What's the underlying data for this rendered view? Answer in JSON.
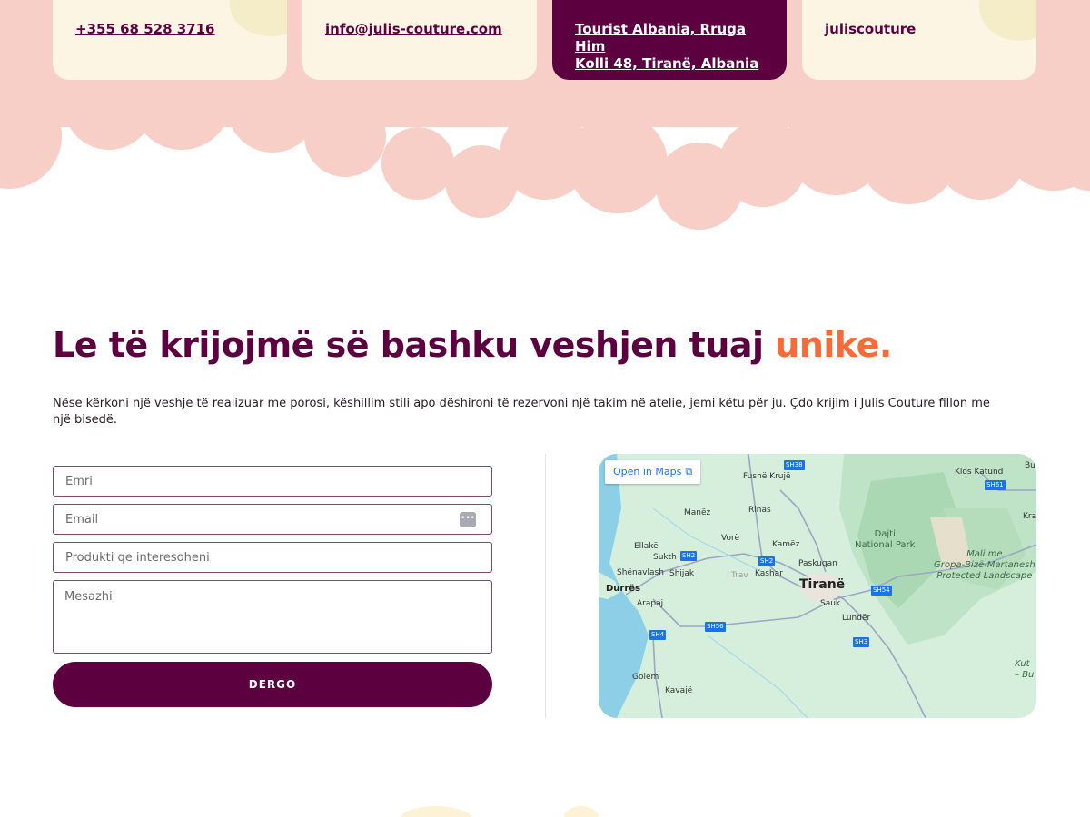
{
  "contacts": {
    "phone": "+355 68 528 3716",
    "email": "info@julis-couture.com",
    "address_line1": "Tourist Albania, Rruga Him",
    "address_line2": "Kolli 48, Tiranë, Albania",
    "instagram": "juliscouture"
  },
  "section": {
    "headline_main": "Le të krijojmë së bashku veshjen tuaj ",
    "headline_accent": "unike.",
    "intro": "Nëse kërkoni një veshje të realizuar me porosi, këshillim stili apo dëshironi të rezervoni një takim në atelie, jemi këtu për ju. Çdo krijim i Julis Couture fillon me një bisedë."
  },
  "form": {
    "name_placeholder": "Emri",
    "email_placeholder": "Email",
    "product_placeholder": "Produkti qe interesoheni",
    "message_placeholder": "Mesazhi",
    "submit_label": "DERGO"
  },
  "map": {
    "open_label": "Open in Maps",
    "labels": {
      "fushe_kruje": "Fushë Krujë",
      "klos_katund": "Klos Katund",
      "manez": "Manëz",
      "rinas": "Rinas",
      "dajti": "Dajti\nNational Park",
      "ellake": "Ellakë",
      "vore": "Vorë",
      "kamez": "Kamëz",
      "sukth": "Sukth",
      "mali_me": "Mali me\nGropa-Bizë-Martanesh\nProtected Landscape",
      "shenavlash": "Shënavlash",
      "shijak": "Shijak",
      "kashar": "Kashar",
      "paskuqan": "Paskuqan",
      "durres": "Durrës",
      "tirane": "Tiranë",
      "sauk": "Sauk",
      "arapaj": "Arapaj",
      "lunder": "Lundër",
      "golem": "Golem",
      "kavaje": "Kavajë",
      "trav": "Trav",
      "kra": "Kra",
      "bu": "Bu",
      "kut": "Kut\n– Bu"
    },
    "shields": {
      "sh38": "SH38",
      "sh61": "SH61",
      "sh2a": "SH2",
      "sh2b": "SH2",
      "sh54": "SH54",
      "sh56": "SH56",
      "sh4": "SH4",
      "sh3": "SH3"
    }
  },
  "colors": {
    "primary": "#5c0040",
    "accent": "#f76b38",
    "cream": "#fdf5e3",
    "pink_cloud": "#f7cfc6"
  }
}
